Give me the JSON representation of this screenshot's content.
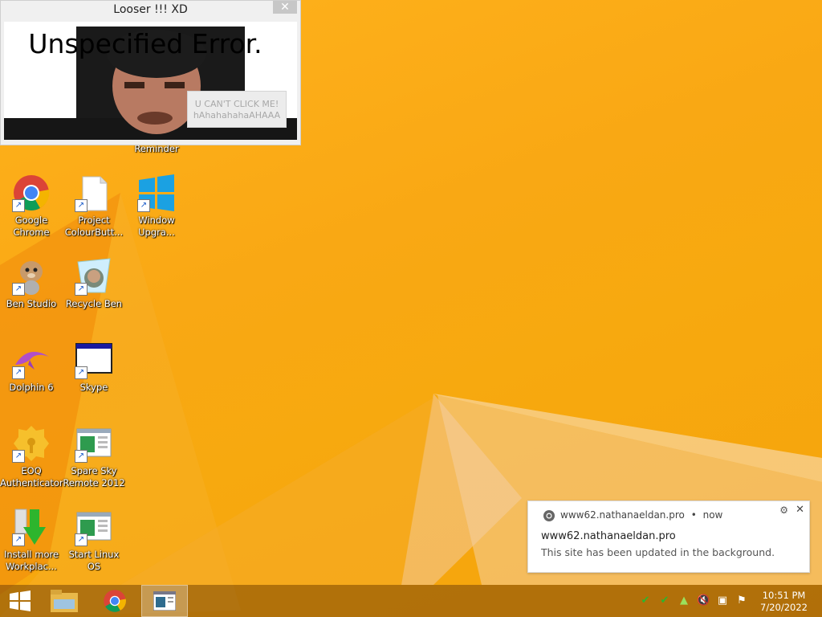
{
  "window": {
    "title": "Looser !!! XD",
    "close_glyph": "✕",
    "error_title": "Unspecified Error.",
    "button_line1": "U CAN'T CLICK ME!",
    "button_line2": "hAhahahahaAHAAA"
  },
  "desktop": {
    "partial_label": "Reminder",
    "icons": [
      {
        "label_line1": "Google",
        "label_line2": "Chrome",
        "icon": "chrome-icon"
      },
      {
        "label_line1": "Project",
        "label_line2": "ColourButt...",
        "icon": "file-icon"
      },
      {
        "label_line1": "Window",
        "label_line2": "Upgra...",
        "icon": "windows-logo-icon"
      },
      {
        "label_line1": "Ben Studio",
        "label_line2": "",
        "icon": "dog-icon"
      },
      {
        "label_line1": "Recycle Ben",
        "label_line2": "",
        "icon": "recycle-ben-icon"
      },
      {
        "label_line1": "Dolphin 6",
        "label_line2": "",
        "icon": "dolphin-icon"
      },
      {
        "label_line1": "Skype",
        "label_line2": "",
        "icon": "window-icon"
      },
      {
        "label_line1": "EOQ",
        "label_line2": "Authenticator",
        "icon": "gear-icon"
      },
      {
        "label_line1": "Spare Sky",
        "label_line2": "Remote 2012",
        "icon": "app-window-icon"
      },
      {
        "label_line1": "Install more",
        "label_line2": "Workplac...",
        "icon": "download-arrow-icon"
      },
      {
        "label_line1": "Start Linux",
        "label_line2": "OS",
        "icon": "app-window-icon"
      }
    ]
  },
  "notification": {
    "site": "www62.nathanaeldan.pro",
    "separator": "•",
    "time": "now",
    "title": "www62.nathanaeldan.pro",
    "body": "This site has been updated in the background.",
    "settings_glyph": "⚙",
    "close_glyph": "✕"
  },
  "taskbar": {
    "time": "10:51 PM",
    "date": "7/20/2022",
    "accent": "#1a5ac8"
  }
}
